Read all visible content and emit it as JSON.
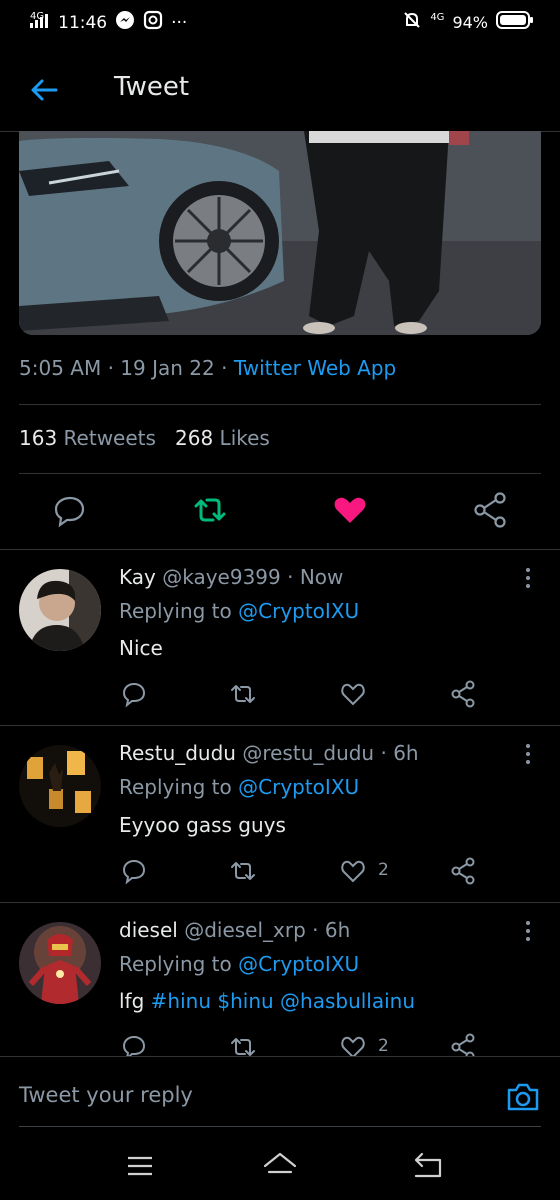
{
  "status": {
    "network": "4G",
    "time": "11:46",
    "more": "···",
    "network2": "4G",
    "battery": "94%"
  },
  "header": {
    "title": "Tweet"
  },
  "tweet": {
    "time": "5:05 AM",
    "sep1": " · ",
    "date": "19 Jan 22",
    "sep2": " · ",
    "app": "Twitter Web App",
    "retweets_count": "163",
    "retweets_label": "Retweets",
    "likes_count": "268",
    "likes_label": "Likes"
  },
  "replies": [
    {
      "name": "Kay",
      "handle": "@kaye9399",
      "time": " · Now",
      "replying_label": "Replying to ",
      "replying_to": "@CryptoIXU",
      "text": "Nice",
      "likes": ""
    },
    {
      "name": "Restu_dudu",
      "handle": "@restu_dudu",
      "time": " · 6h",
      "replying_label": "Replying to ",
      "replying_to": "@CryptoIXU",
      "text": "Eyyoo gass guys",
      "likes": "2"
    },
    {
      "name": "diesel",
      "handle": "@diesel_xrp",
      "time": " · 6h",
      "replying_label": "Replying to ",
      "replying_to": "@CryptoIXU",
      "text_pre": "lfg ",
      "links": [
        "#hinu",
        "$hinu",
        "@hasbullainu"
      ],
      "likes": "2"
    }
  ],
  "composer": {
    "placeholder": "Tweet your reply"
  },
  "colors": {
    "accent": "#1d9bf0",
    "retweet": "#00ba7c",
    "like": "#f91880",
    "muted": "#8b98a5"
  },
  "icons": [
    "back-arrow-icon",
    "reply-icon",
    "retweet-icon",
    "heart-icon",
    "share-icon",
    "more-icon",
    "camera-icon",
    "menu-icon",
    "home-icon",
    "back-icon"
  ]
}
